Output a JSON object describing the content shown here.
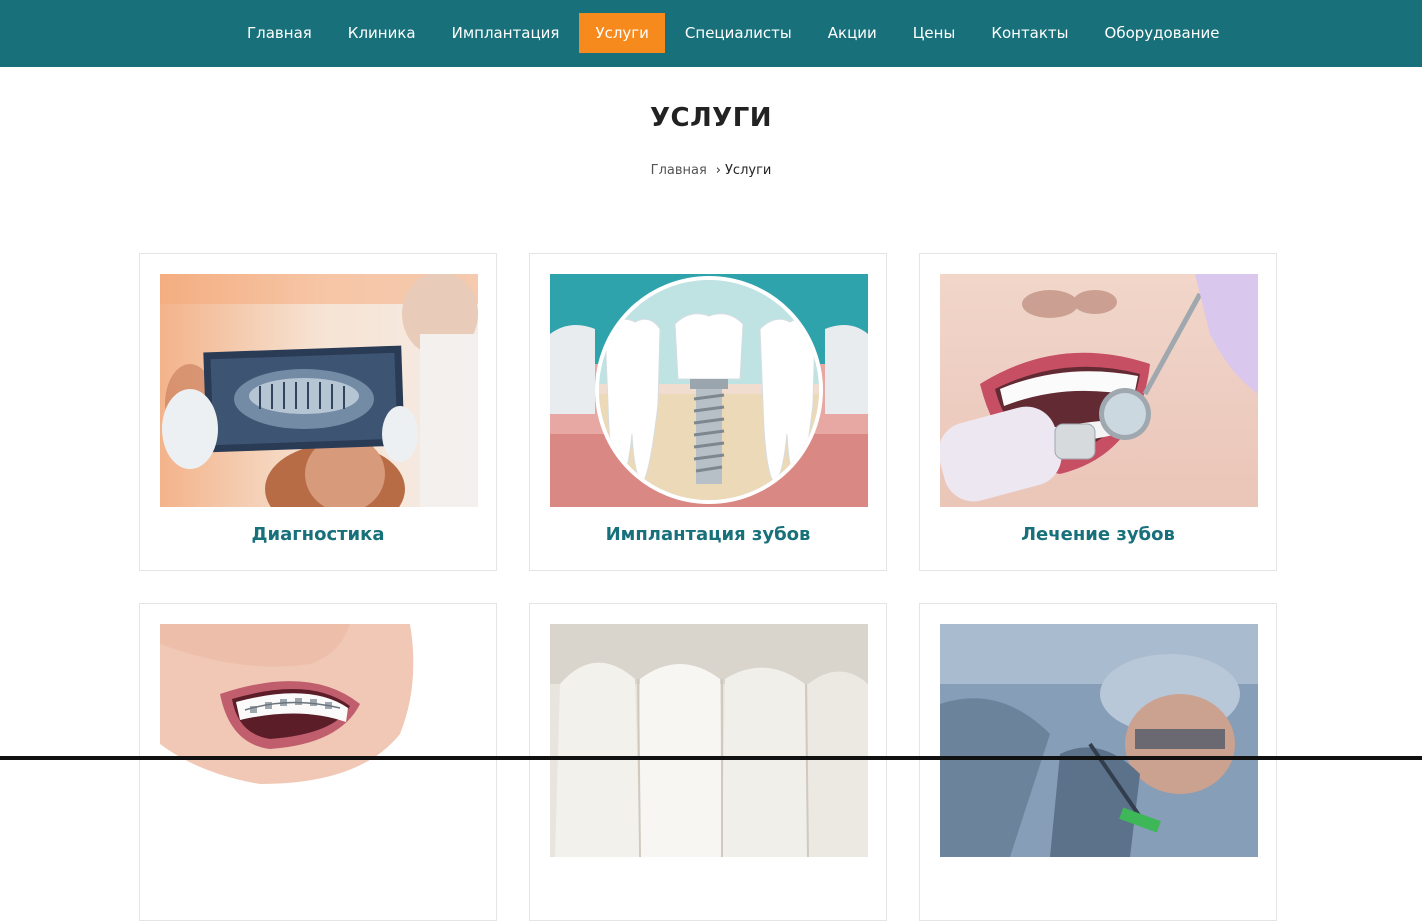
{
  "nav": {
    "items": [
      {
        "label": "Главная"
      },
      {
        "label": "Клиника"
      },
      {
        "label": "Имплантация"
      },
      {
        "label": "Услуги",
        "active": true
      },
      {
        "label": "Специалисты"
      },
      {
        "label": "Акции"
      },
      {
        "label": "Цены"
      },
      {
        "label": "Контакты"
      },
      {
        "label": "Оборудование"
      }
    ]
  },
  "page": {
    "title": "УСЛУГИ"
  },
  "breadcrumb": {
    "home": "Главная",
    "separator": "›",
    "current": "Услуги"
  },
  "services": [
    {
      "title": "Диагностика",
      "image": "dental-xray-photo"
    },
    {
      "title": "Имплантация зубов",
      "image": "dental-implant-illustration"
    },
    {
      "title": "Лечение зубов",
      "image": "teeth-treatment-photo"
    },
    {
      "title": "",
      "image": "braces-smile-photo"
    },
    {
      "title": "",
      "image": "dental-crowns-photo"
    },
    {
      "title": "",
      "image": "dental-surgery-photo"
    }
  ],
  "colors": {
    "nav_bg": "#17707a",
    "nav_active": "#f78a1d",
    "card_title": "#17707a"
  }
}
